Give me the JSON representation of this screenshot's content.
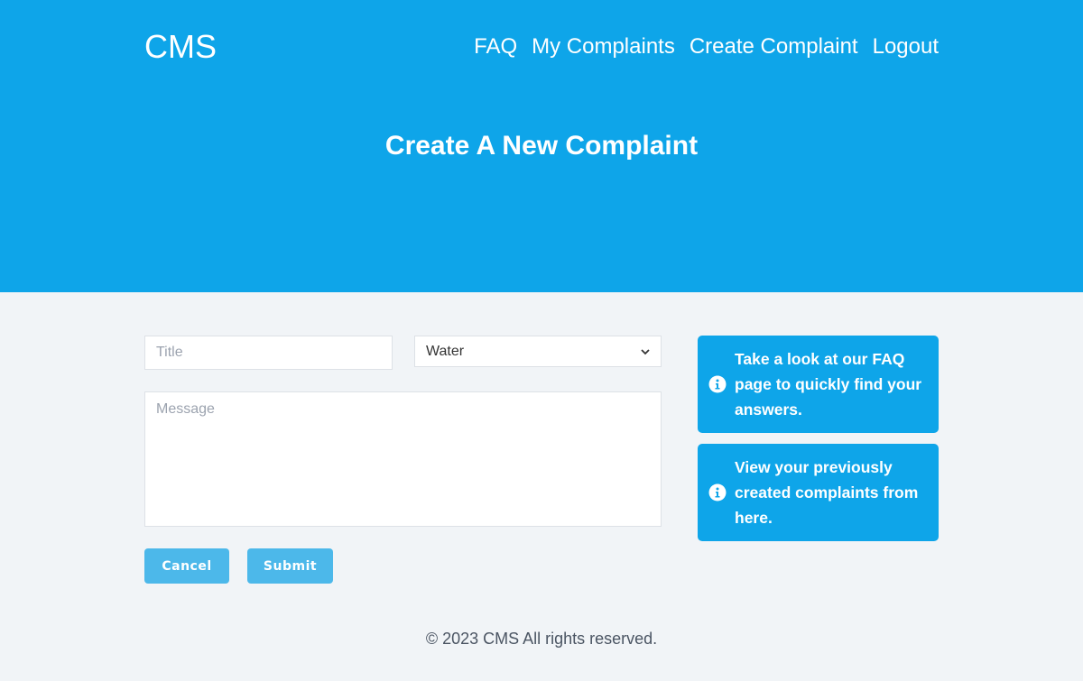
{
  "header": {
    "brand": "CMS",
    "nav": [
      "FAQ",
      "My Complaints",
      "Create Complaint",
      "Logout"
    ],
    "page_title": "Create A New Complaint"
  },
  "form": {
    "title_placeholder": "Title",
    "title_value": "",
    "category_selected": "Water",
    "message_placeholder": "Message",
    "message_value": "",
    "cancel_label": "Cancel",
    "submit_label": "Submit"
  },
  "info_cards": [
    {
      "icon": "info-circle-icon",
      "text": "Take a look at our FAQ page to quickly find your answers."
    },
    {
      "icon": "info-circle-icon",
      "text": "View your previously created complaints from here."
    }
  ],
  "footer": {
    "copyright": "© 2023 CMS All rights reserved."
  },
  "colors": {
    "primary": "#0ea5e9",
    "button": "#4cb8ea",
    "background": "#f1f4f7"
  }
}
